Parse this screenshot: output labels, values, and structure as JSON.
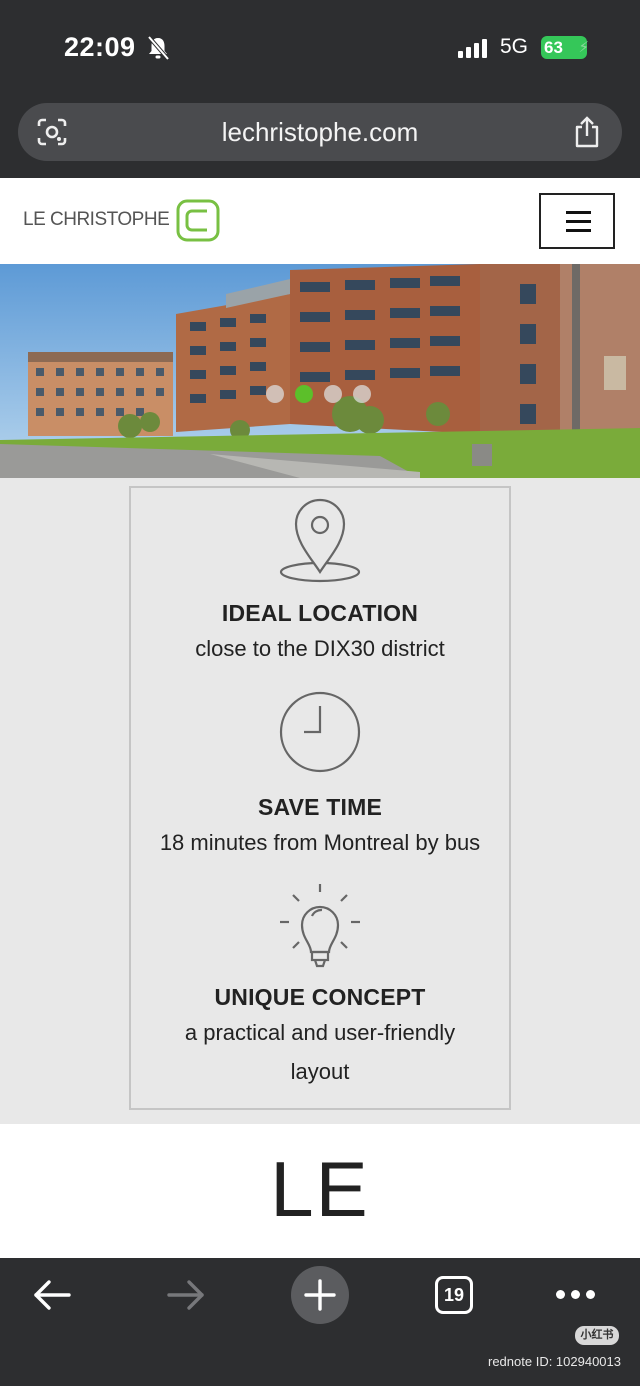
{
  "status_bar": {
    "time": "22:09",
    "network": "5G",
    "battery": "63"
  },
  "browser": {
    "url": "lechristophe.com",
    "tab_count": "19"
  },
  "site": {
    "logo_text": "LE CHRISTOPHE",
    "brand_color": "#78c043"
  },
  "hero": {
    "slides": 4,
    "active_slide": 2
  },
  "features": [
    {
      "icon": "location-pin-icon",
      "title": "IDEAL LOCATION",
      "text": "close to the DIX30 district"
    },
    {
      "icon": "clock-icon",
      "title": "SAVE TIME",
      "text": "18 minutes from Montreal by bus"
    },
    {
      "icon": "lightbulb-icon",
      "title": "UNIQUE CONCEPT",
      "text_line1": "a practical and user-friendly",
      "text_line2": "layout"
    }
  ],
  "section_heading": "LE",
  "watermark": {
    "badge": "小红书",
    "id_text": "rednote ID: 102940013"
  }
}
